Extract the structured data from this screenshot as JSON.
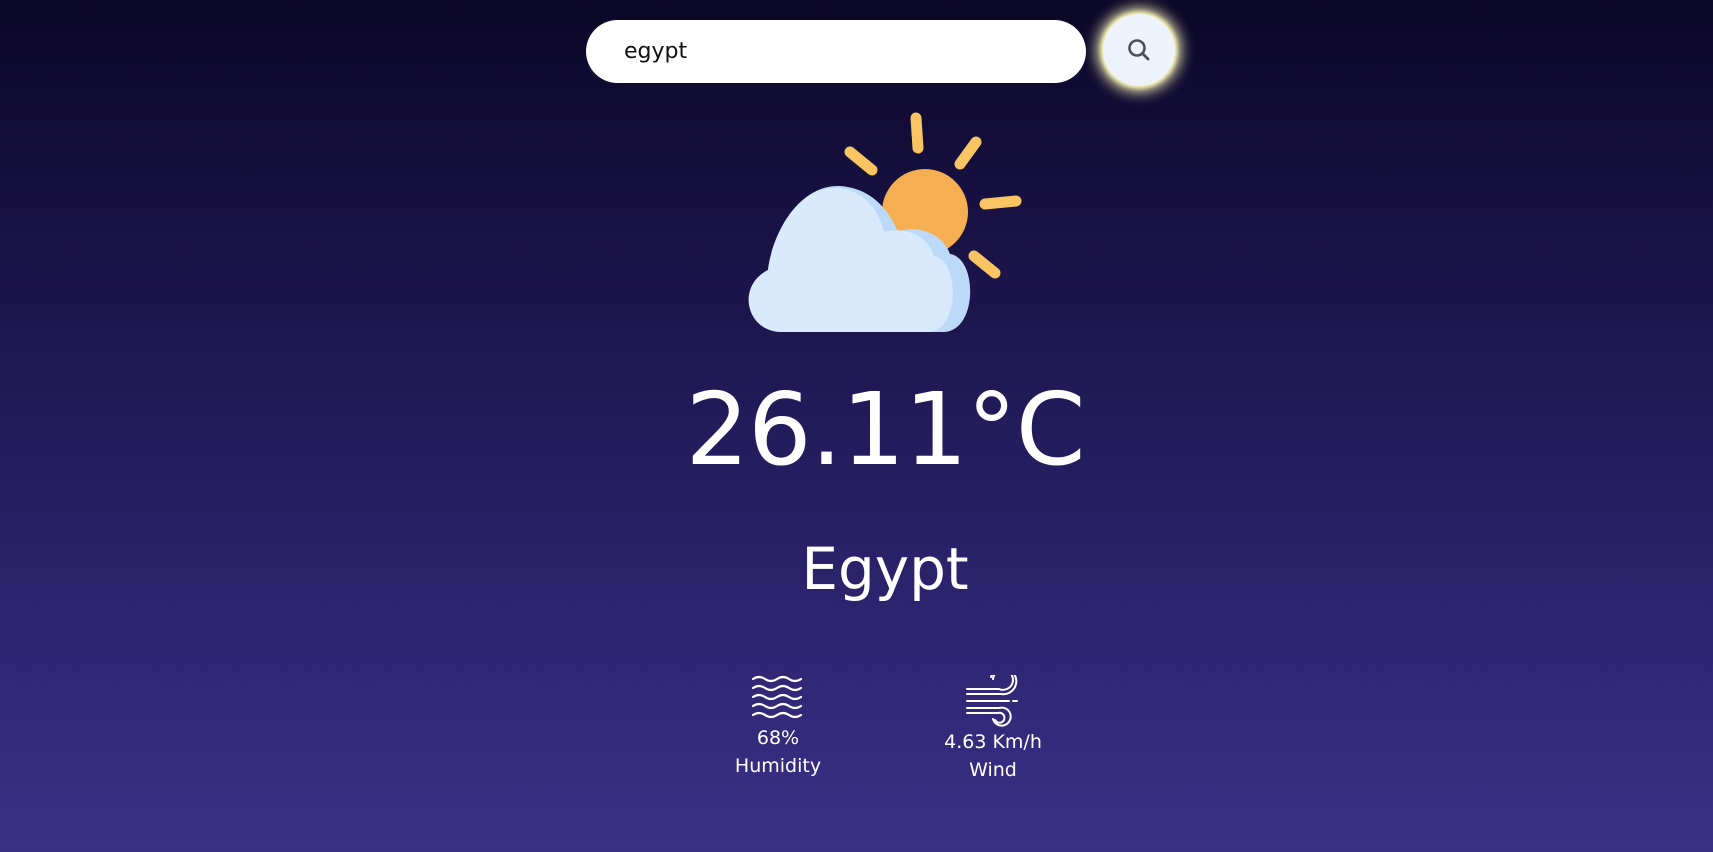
{
  "search": {
    "value": "egypt",
    "button_icon": "search-icon"
  },
  "weather": {
    "icon": "partly-cloudy-icon",
    "temperature": "26.11°C",
    "city": "Egypt"
  },
  "details": {
    "humidity": {
      "icon": "humidity-waves-icon",
      "value": "68%",
      "label": "Humidity"
    },
    "wind": {
      "icon": "wind-icon",
      "value": "4.63 Km/h",
      "label": "Wind"
    }
  },
  "colors": {
    "background_top": "#0b0726",
    "background_bottom": "#3b3088",
    "sun": "#f5ae52",
    "sun_rays": "#f9c563",
    "cloud": "#d8eafb",
    "cloud_shade": "#bcd9f7"
  }
}
